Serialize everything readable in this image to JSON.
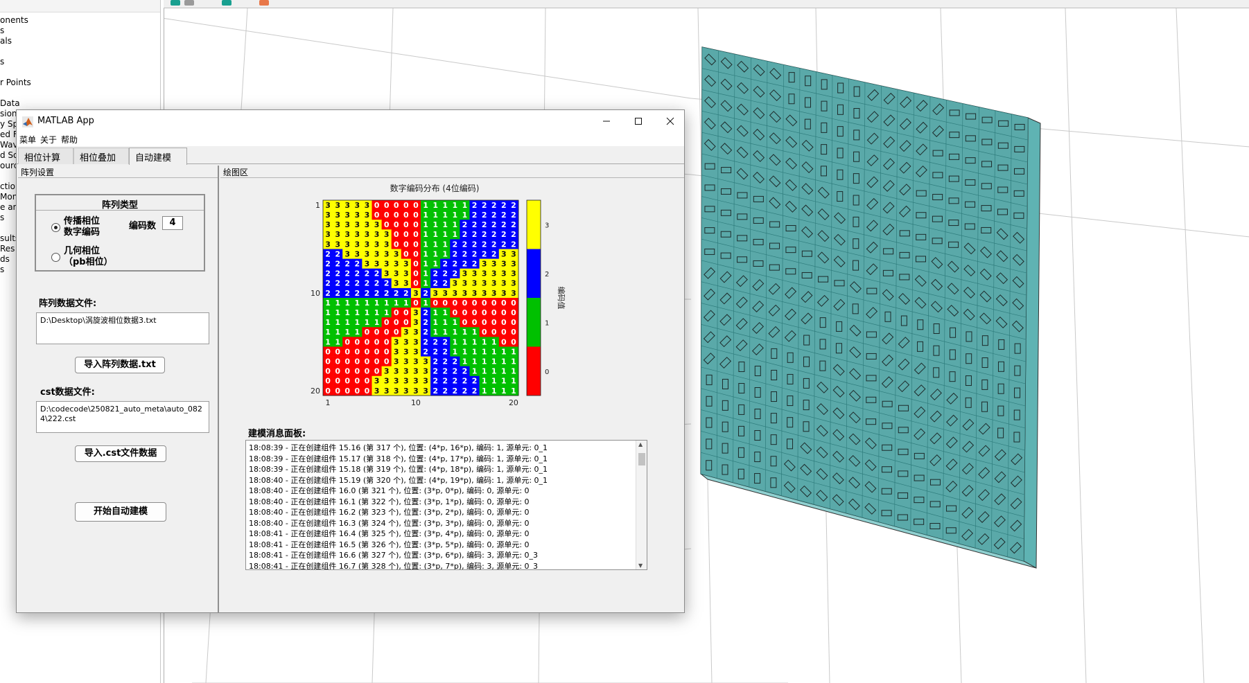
{
  "background_app": {
    "tree_items": [
      "onents",
      "s",
      "als",
      "",
      "s",
      "",
      "r Points",
      "",
      "Data",
      "sion",
      "y Sp",
      "ed F",
      "Wav",
      "d So",
      "ourc",
      "",
      "ction",
      "Moni",
      "e ar",
      "s",
      "",
      "sults",
      "Res",
      "ds",
      "s"
    ]
  },
  "window": {
    "title": "MATLAB App",
    "minimize_icon": "minimize-icon",
    "maximize_icon": "maximize-icon",
    "close_icon": "close-icon"
  },
  "menu": {
    "items": [
      "菜单",
      "关于",
      "帮助"
    ]
  },
  "tabs": [
    {
      "label": "相位计算",
      "active": false
    },
    {
      "label": "相位叠加",
      "active": false
    },
    {
      "label": "自动建模",
      "active": true
    }
  ],
  "left_panel": {
    "title": "阵列设置",
    "array_type": {
      "title": "阵列类型",
      "option1_line1": "传播相位",
      "option1_line2": "数字编码",
      "option2_line1": "几何相位",
      "option2_line2": "（pb相位）",
      "selected": "传播相位 数字编码",
      "code_count_label": "编码数",
      "code_count_value": "4"
    },
    "array_file_label": "阵列数据文件:",
    "array_file_value": "D:\\Desktop\\涡旋波相位数据3.txt",
    "import_array_button": "导入阵列数据.txt",
    "cst_file_label": "cst数据文件:",
    "cst_file_value": "D:\\codecode\\250821_auto_meta\\auto_0824\\222.cst",
    "import_cst_button": "导入.cst文件数据",
    "start_button": "开始自动建模"
  },
  "right_panel": {
    "title": "绘图区",
    "message_label": "建模消息面板:",
    "messages": [
      "18:08:39 - 正在创建组件 15.16 (第 317 个), 位置: (4*p, 16*p), 编码: 1, 源单元: 0_1",
      "18:08:39 - 正在创建组件 15.17 (第 318 个), 位置: (4*p, 17*p), 编码: 1, 源单元: 0_1",
      "18:08:39 - 正在创建组件 15.18 (第 319 个), 位置: (4*p, 18*p), 编码: 1, 源单元: 0_1",
      "18:08:40 - 正在创建组件 15.19 (第 320 个), 位置: (4*p, 19*p), 编码: 1, 源单元: 0_1",
      "18:08:40 - 正在创建组件 16.0 (第 321 个), 位置: (3*p, 0*p), 编码: 0, 源单元: 0",
      "18:08:40 - 正在创建组件 16.1 (第 322 个), 位置: (3*p, 1*p), 编码: 0, 源单元: 0",
      "18:08:40 - 正在创建组件 16.2 (第 323 个), 位置: (3*p, 2*p), 编码: 0, 源单元: 0",
      "18:08:40 - 正在创建组件 16.3 (第 324 个), 位置: (3*p, 3*p), 编码: 0, 源单元: 0",
      "18:08:41 - 正在创建组件 16.4 (第 325 个), 位置: (3*p, 4*p), 编码: 0, 源单元: 0",
      "18:08:41 - 正在创建组件 16.5 (第 326 个), 位置: (3*p, 5*p), 编码: 0, 源单元: 0",
      "18:08:41 - 正在创建组件 16.6 (第 327 个), 位置: (3*p, 6*p), 编码: 3, 源单元: 0_3",
      "18:08:41 - 正在创建组件 16.7 (第 328 个), 位置: (3*p, 7*p), 编码: 3, 源单元: 0_3"
    ]
  },
  "chart_data": {
    "type": "heatmap",
    "title": "数字编码分布 (4位编码)",
    "colorbar_label": "编码值",
    "colorbar_ticks": [
      "0",
      "1",
      "2",
      "3"
    ],
    "colors": {
      "0": "#ff0000",
      "1": "#00c000",
      "2": "#0000ff",
      "3": "#ffff00"
    },
    "x_ticks": [
      "1",
      "10",
      "20"
    ],
    "y_ticks": [
      "1",
      "10",
      "20"
    ],
    "rows": [
      "33333000001111122222",
      "33333000001111122222",
      "33333300001111222222",
      "33333330001111222222",
      "33333330001112222222",
      "22333333001112222233",
      "22223333301122223333",
      "22222233301222333333",
      "22222223301223333333",
      "22222222232333333333",
      "11111111101000000000",
      "11111110032110000000",
      "11111100032111000000",
      "11110000332111110000",
      "11000003332221111100",
      "00000003332221111111",
      "00000003333222111111",
      "00000033333222211111",
      "00000333333222221111",
      "00000333333222221111"
    ]
  }
}
